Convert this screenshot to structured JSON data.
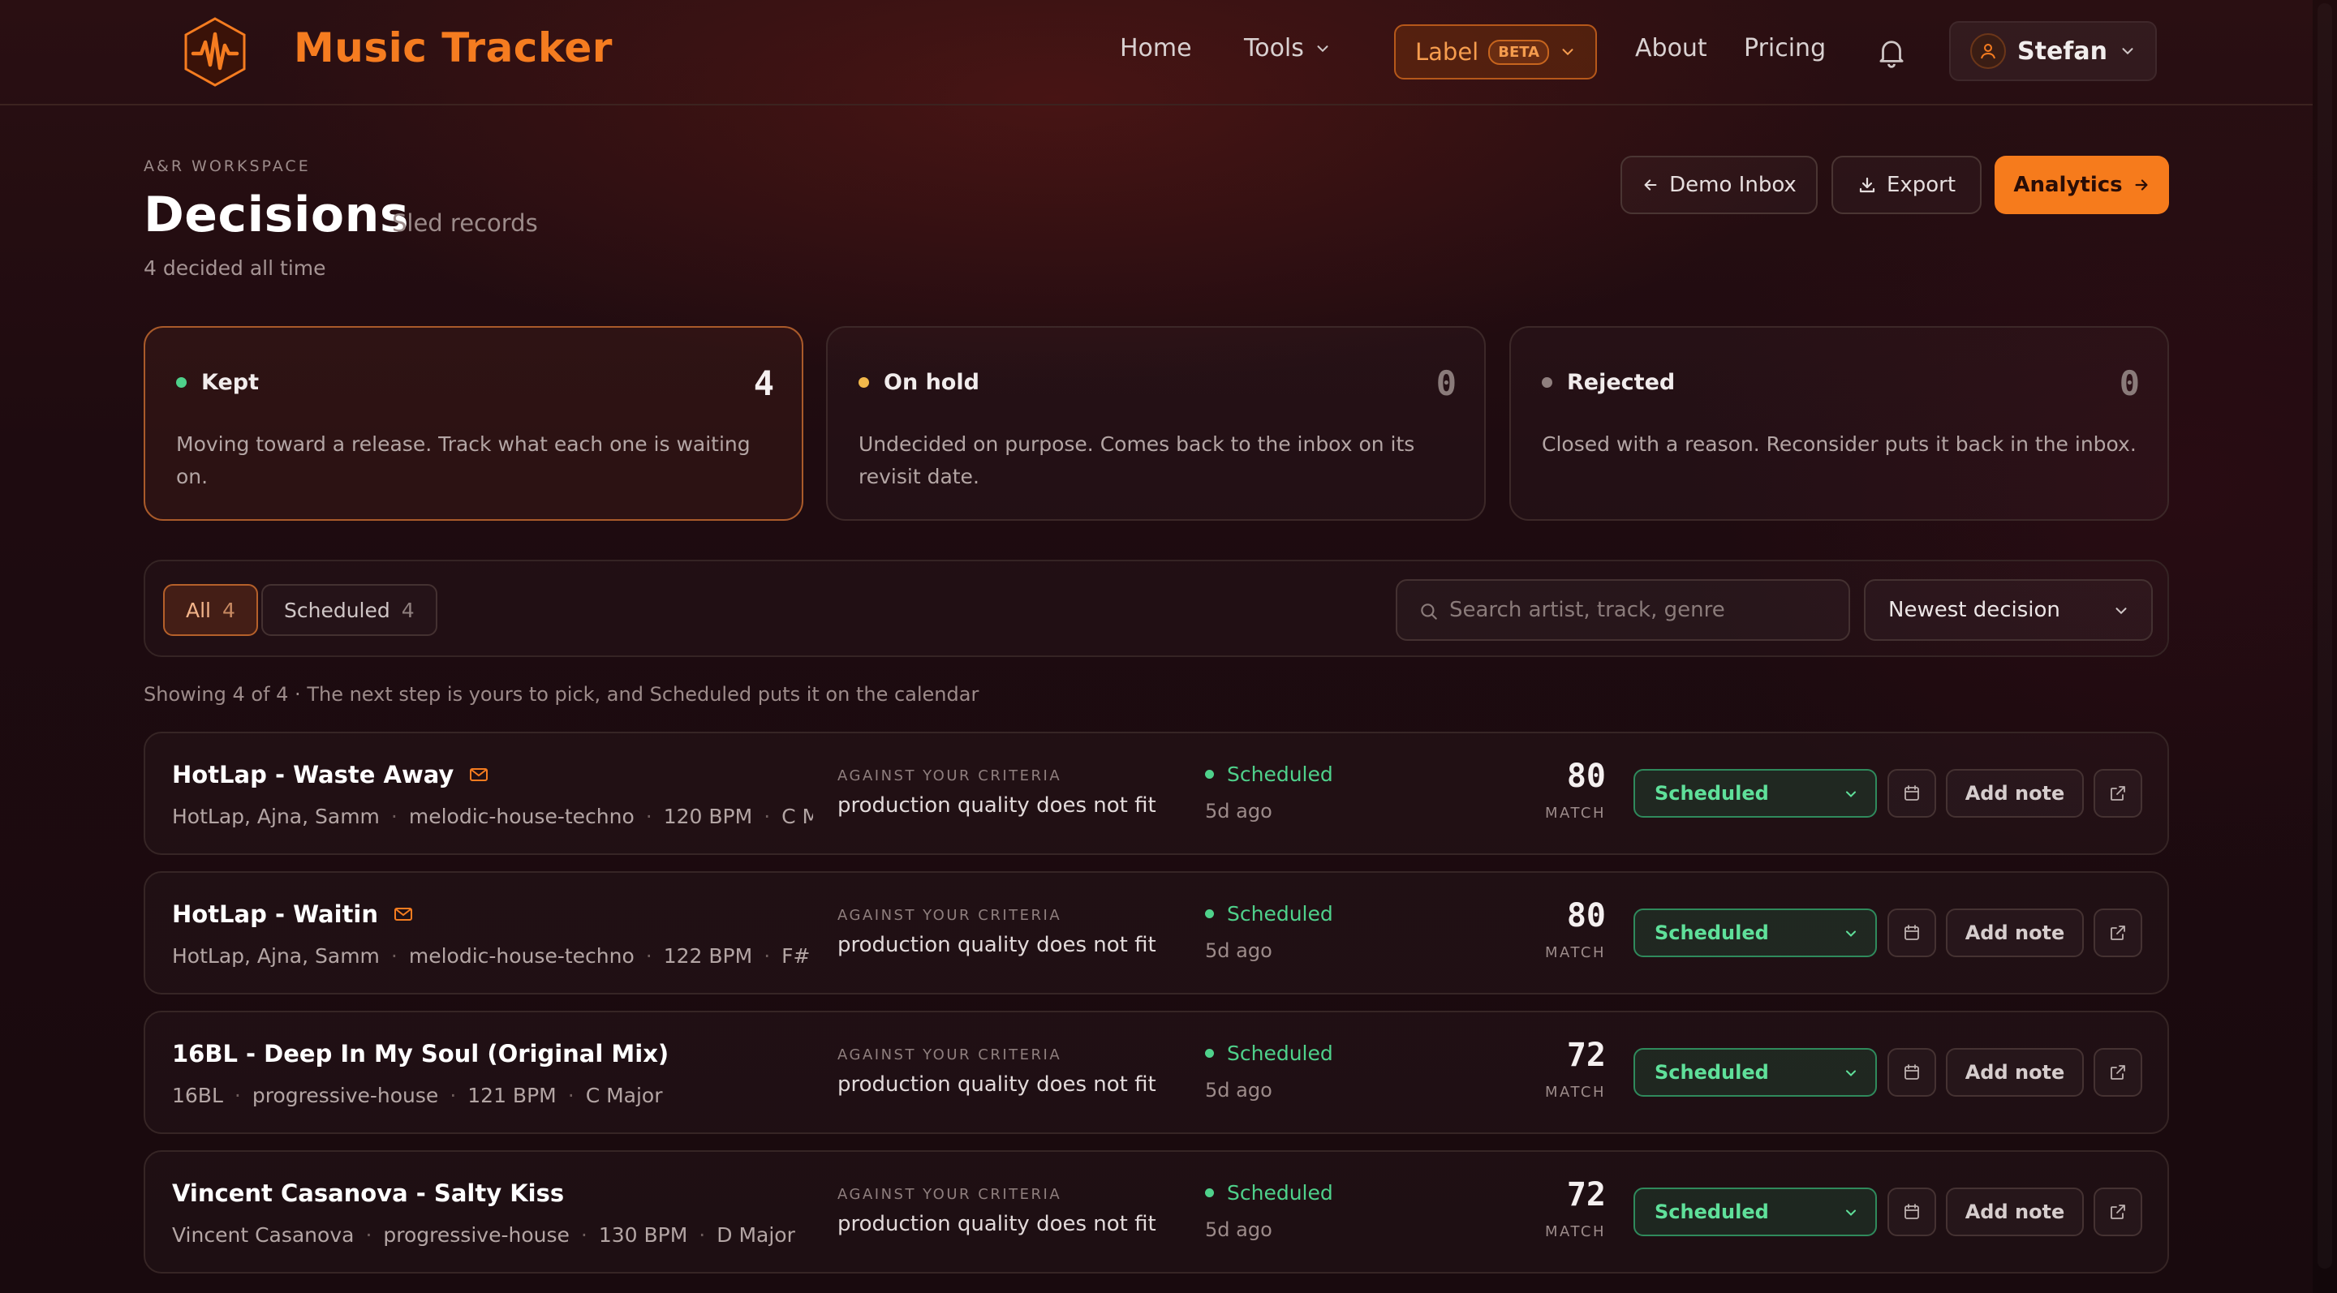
{
  "header": {
    "brand": "Music Tracker",
    "nav": {
      "home": "Home",
      "tools": "Tools",
      "about": "About",
      "pricing": "Pricing"
    },
    "label_menu": {
      "label": "Label",
      "badge": "BETA"
    },
    "user": {
      "name": "Stefan"
    },
    "brand_color": "#f57c20"
  },
  "page": {
    "eyebrow": "A&R WORKSPACE",
    "title": "Decisions",
    "subtitle": "Sled records",
    "count_text": "4 decided all time",
    "actions": {
      "demo_inbox": "Demo Inbox",
      "export": "Export",
      "analytics": "Analytics"
    }
  },
  "stats": [
    {
      "label": "Kept",
      "count": "4",
      "description": "Moving toward a release. Track what each one is waiting on.",
      "dot_color": "#4fd18b",
      "active": true
    },
    {
      "label": "On hold",
      "count": "0",
      "description": "Undecided on purpose. Comes back to the inbox on its revisit date.",
      "dot_color": "#f2b84b",
      "active": false
    },
    {
      "label": "Rejected",
      "count": "0",
      "description": "Closed with a reason. Reconsider puts it back in the inbox.",
      "dot_color": "#8f7f7e",
      "active": false
    }
  ],
  "filters": {
    "chips": [
      {
        "label": "All",
        "count": "4",
        "active": true
      },
      {
        "label": "Scheduled",
        "count": "4",
        "active": false
      }
    ],
    "search_placeholder": "Search artist, track, genre",
    "sort_value": "Newest decision"
  },
  "showing_text": "Showing 4 of 4 · The next step is yours to pick, and Scheduled puts it on the calendar",
  "rows": [
    {
      "title": "HotLap - Waste Away",
      "has_mail": true,
      "artists": "HotLap, Ajna, Samm",
      "genre": "melodic-house-techno",
      "bpm": "120 BPM",
      "key": "C Minor",
      "criteria_label": "AGAINST YOUR CRITERIA",
      "criteria": "production quality does not fit",
      "status": "Scheduled",
      "ago": "5d ago",
      "score": "80",
      "score_label": "MATCH",
      "select_value": "Scheduled",
      "note_label": "Add note"
    },
    {
      "title": "HotLap - Waitin",
      "has_mail": true,
      "artists": "HotLap, Ajna, Samm",
      "genre": "melodic-house-techno",
      "bpm": "122 BPM",
      "key": "F# Minor",
      "criteria_label": "AGAINST YOUR CRITERIA",
      "criteria": "production quality does not fit",
      "status": "Scheduled",
      "ago": "5d ago",
      "score": "80",
      "score_label": "MATCH",
      "select_value": "Scheduled",
      "note_label": "Add note"
    },
    {
      "title": "16BL - Deep In My Soul (Original Mix)",
      "has_mail": false,
      "artists": "16BL",
      "genre": "progressive-house",
      "bpm": "121 BPM",
      "key": "C Major",
      "criteria_label": "AGAINST YOUR CRITERIA",
      "criteria": "production quality does not fit",
      "status": "Scheduled",
      "ago": "5d ago",
      "score": "72",
      "score_label": "MATCH",
      "select_value": "Scheduled",
      "note_label": "Add note"
    },
    {
      "title": "Vincent Casanova - Salty Kiss",
      "has_mail": false,
      "artists": "Vincent Casanova",
      "genre": "progressive-house",
      "bpm": "130 BPM",
      "key": "D Major",
      "criteria_label": "AGAINST YOUR CRITERIA",
      "criteria": "production quality does not fit",
      "status": "Scheduled",
      "ago": "5d ago",
      "score": "72",
      "score_label": "MATCH",
      "select_value": "Scheduled",
      "note_label": "Add note"
    }
  ]
}
